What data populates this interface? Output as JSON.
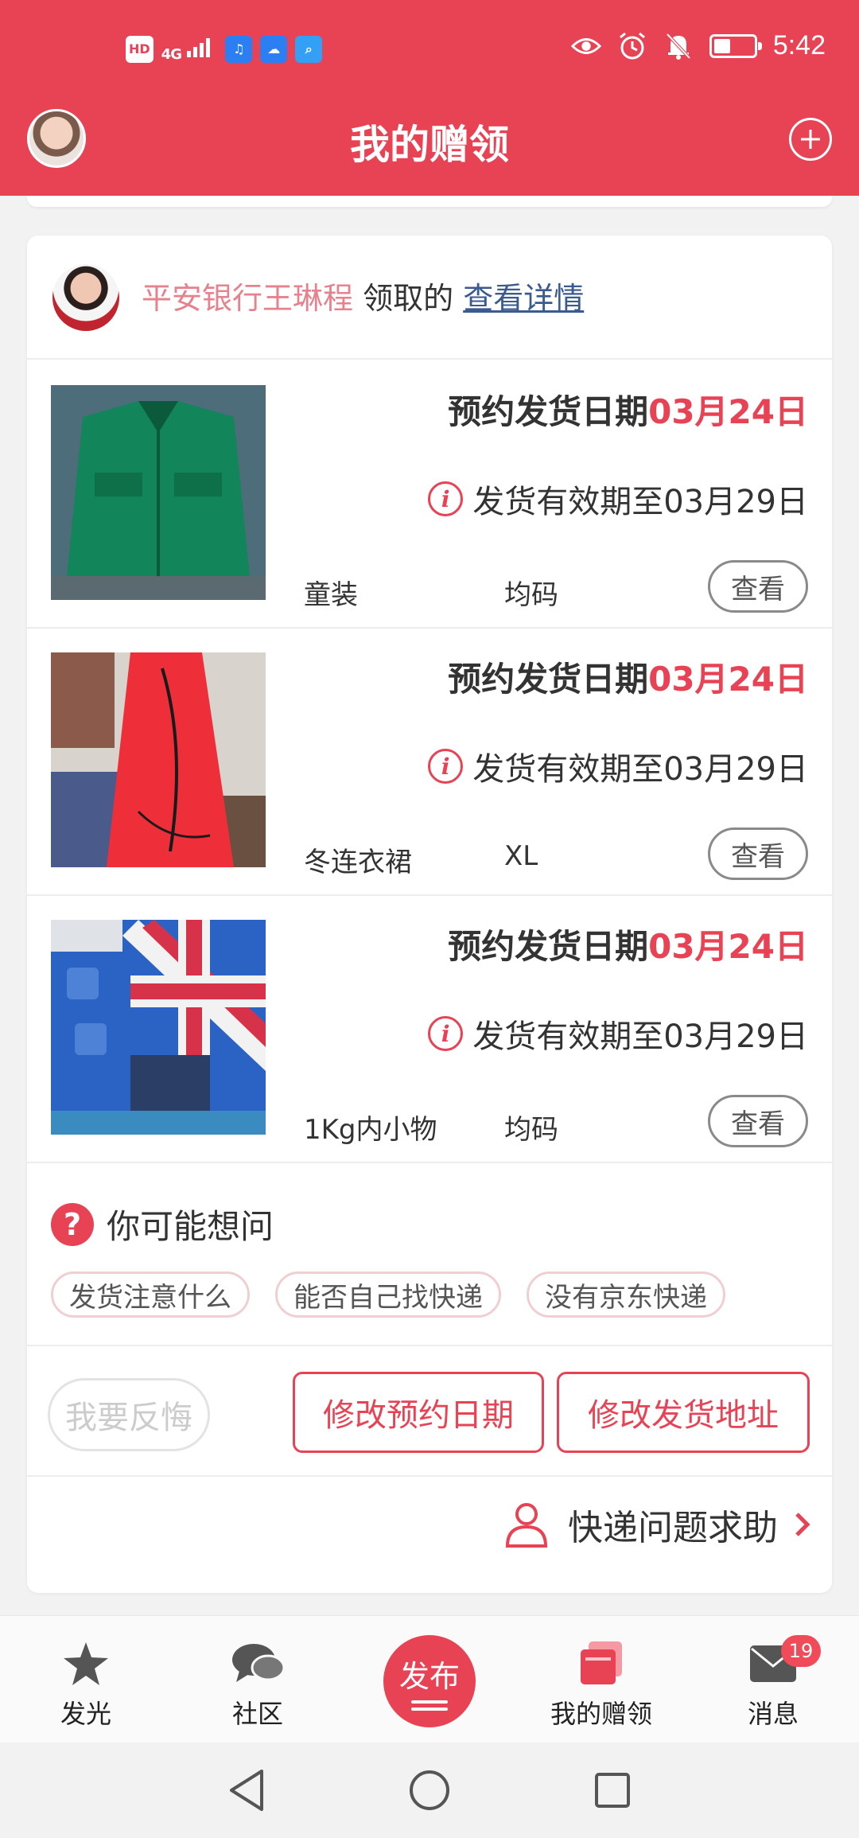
{
  "status_bar": {
    "time": "5:42",
    "left_badges": [
      "HD",
      "4G"
    ],
    "icons": [
      "eye-icon",
      "alarm-icon",
      "bell-off-icon",
      "battery-icon"
    ]
  },
  "header": {
    "title": "我的赠领"
  },
  "giver": {
    "name": "平安银行王琳程",
    "action": " 领取的 ",
    "link": "查看详情"
  },
  "items": [
    {
      "booking_label": "预约发货日期",
      "booking_date": "03月24日",
      "valid_text": "发货有效期至03月29日",
      "category": "童装",
      "size": "均码",
      "view_label": "查看",
      "image": "green-jacket"
    },
    {
      "booking_label": "预约发货日期",
      "booking_date": "03月24日",
      "valid_text": "发货有效期至03月29日",
      "category": "冬连衣裙",
      "size": "XL",
      "view_label": "查看",
      "image": "red-dress"
    },
    {
      "booking_label": "预约发货日期",
      "booking_date": "03月24日",
      "valid_text": "发货有效期至03月29日",
      "category": "1Kg内小物",
      "size": "均码",
      "view_label": "查看",
      "image": "union-jack-cloth"
    }
  ],
  "faq": {
    "title": "你可能想问",
    "chips": [
      "发货注意什么",
      "能否自己找快递",
      "没有京东快递"
    ]
  },
  "actions": {
    "regret": "我要反悔",
    "change_date": "修改预约日期",
    "change_address": "修改发货地址"
  },
  "help": {
    "label": "快递问题求助"
  },
  "tabbar": {
    "tabs": [
      {
        "label": "发光",
        "icon": "star-icon"
      },
      {
        "label": "社区",
        "icon": "chat-icon"
      },
      {
        "label": "发布",
        "icon": "publish-icon"
      },
      {
        "label": "我的赠领",
        "icon": "gift-cards-icon"
      },
      {
        "label": "消息",
        "icon": "mail-icon"
      }
    ],
    "message_badge": "19"
  },
  "colors": {
    "brand": "#e84354",
    "link": "#3b5a8f",
    "giver_name": "#e6828d"
  }
}
